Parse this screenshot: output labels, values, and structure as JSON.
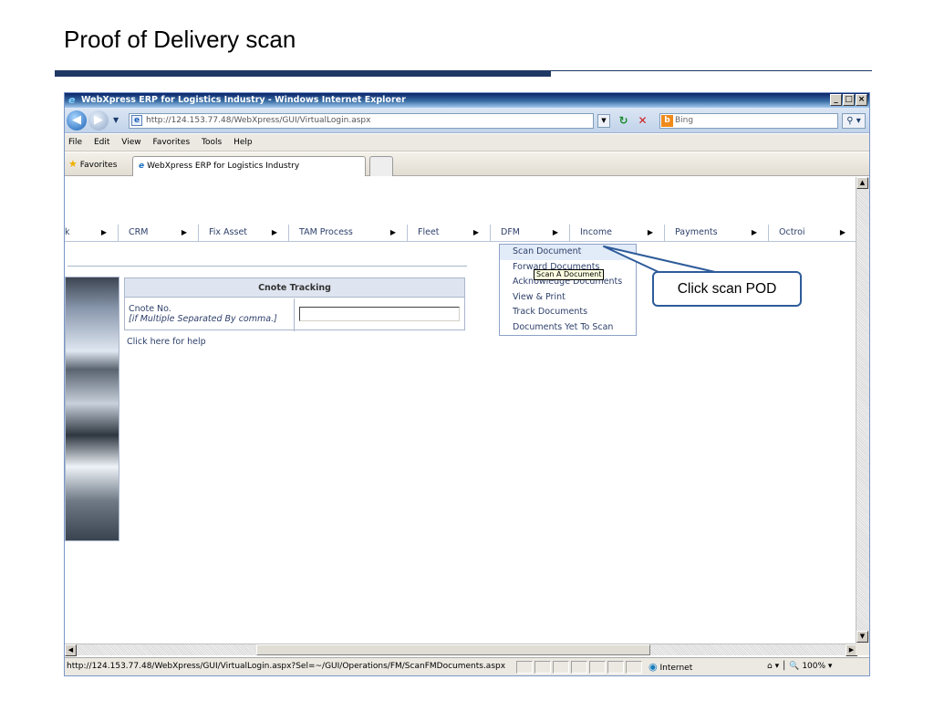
{
  "slide": {
    "title": "Proof of Delivery scan",
    "callout": "Click scan POD"
  },
  "window": {
    "title": "WebXpress ERP for Logistics Industry - Windows Internet Explorer",
    "address": "http://124.153.77.48/WebXpress/GUI/VirtualLogin.aspx",
    "search_placeholder": "Bing",
    "menu": [
      "File",
      "Edit",
      "View",
      "Favorites",
      "Tools",
      "Help"
    ],
    "favorites_label": "Favorites",
    "tab_label": "WebXpress ERP for Logistics Industry",
    "status_url": "http://124.153.77.48/WebXpress/GUI/VirtualLogin.aspx?Sel=~/GUI/Operations/FM/ScanFMDocuments.aspx",
    "zone": "Internet",
    "zoom": "100%"
  },
  "app_menu": [
    {
      "label": "k",
      "has_arrow": true
    },
    {
      "label": "CRM",
      "has_arrow": true
    },
    {
      "label": "Fix Asset",
      "has_arrow": true
    },
    {
      "label": "TAM Process",
      "has_arrow": true
    },
    {
      "label": "Fleet",
      "has_arrow": true
    },
    {
      "label": "DFM",
      "has_arrow": true
    },
    {
      "label": "Income",
      "has_arrow": true
    },
    {
      "label": "Payments",
      "has_arrow": true
    },
    {
      "label": "Octroi",
      "has_arrow": true
    }
  ],
  "dfm_dropdown": [
    "Scan Document",
    "Forward Documents",
    "Acknowledge Documents",
    "View & Print",
    "Track Documents",
    "Documents Yet To Scan"
  ],
  "tooltip": "Scan A Document",
  "cnote": {
    "heading": "Cnote Tracking",
    "label": "Cnote No.",
    "hint": "[if Multiple Separated By comma.]",
    "input_value": "",
    "help": "Click here for help"
  },
  "icons": {
    "ie_logo": "ie-logo-icon",
    "back": "back-arrow-icon",
    "forward": "forward-arrow-icon",
    "refresh": "refresh-icon",
    "stop": "stop-icon",
    "search": "search-icon",
    "globe": "globe-icon",
    "favorites_star": "star-icon"
  }
}
